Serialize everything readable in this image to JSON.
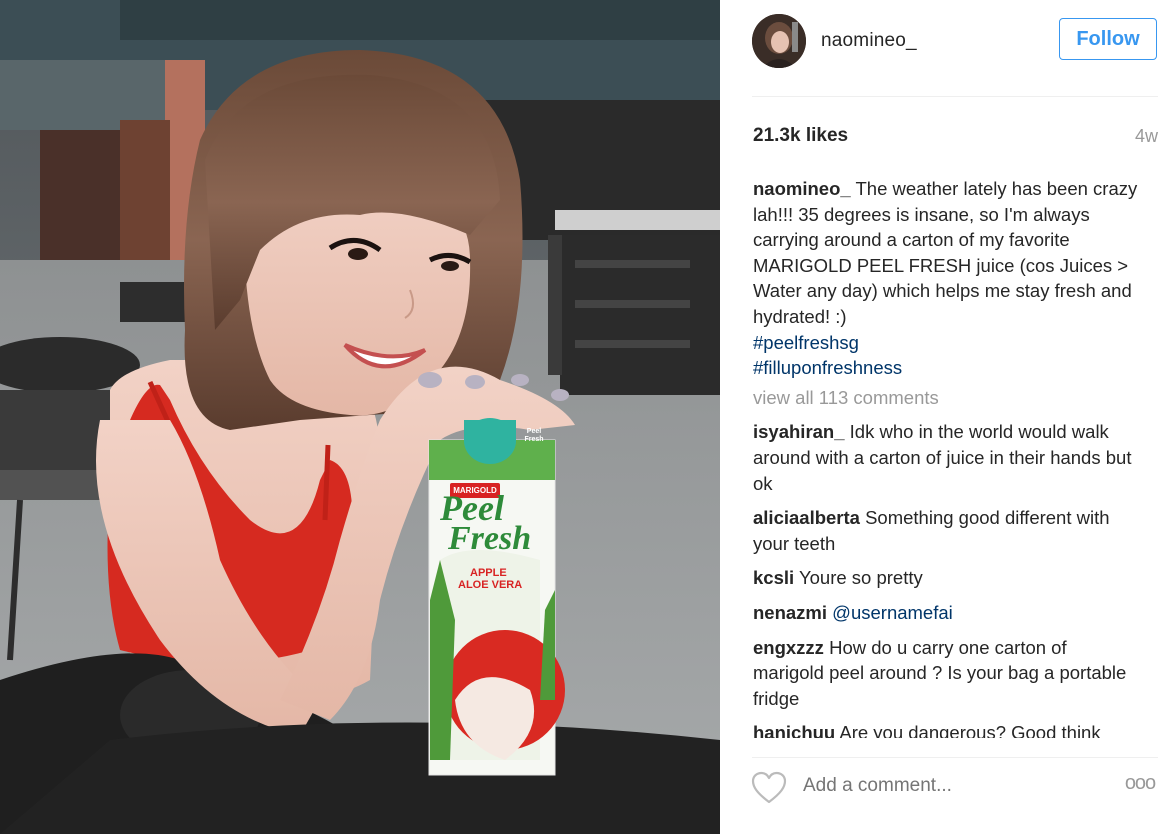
{
  "post": {
    "username": "naomineo_",
    "follow_label": "Follow",
    "likes": "21.3k likes",
    "age": "4w",
    "caption": {
      "user": "naomineo_",
      "text": "The weather lately has been crazy lah!!! 35 degrees is insane, so I'm always carrying around a carton of my favorite MARIGOLD PEEL FRESH juice (cos Juices > Water any day) which helps me stay fresh and hydrated! :)",
      "hashtags": [
        "#peelfreshsg",
        "#filluponfreshness"
      ]
    },
    "view_all_comments": "view all 113 comments",
    "comments": [
      {
        "user": "isyahiran_",
        "text": "Idk who in the world would walk around with a carton of juice in their hands but ok"
      },
      {
        "user": "aliciaalberta",
        "text": "Something good different with your teeth"
      },
      {
        "user": "kcsli",
        "text": "Youre so pretty"
      },
      {
        "user": "nenazmi",
        "mention": "@usernamefai"
      },
      {
        "user": "engxzzz",
        "text": "How do u carry one carton of marigold peel around ? Is your bag a portable fridge"
      },
      {
        "user": "hanichuu",
        "text": "Are you dangerous? Good think"
      }
    ],
    "add_comment_placeholder": "Add a comment...",
    "more_label": "ooo"
  },
  "product": {
    "brand": "MARIGOLD",
    "name_line1": "Peel",
    "name_line2": "Fresh",
    "flavor_line1": "APPLE",
    "flavor_line2": "ALOE VERA",
    "corner_logo": "Peel Fresh"
  },
  "icons": {
    "heart": "heart-outline-icon",
    "more": "more-options-icon"
  },
  "colors": {
    "follow_blue": "#3897f0",
    "hashtag": "#003569",
    "muted": "#999999",
    "carton_green": "#2e8b3a",
    "cap_teal": "#2fb3a0",
    "top_red": "#d82323"
  }
}
